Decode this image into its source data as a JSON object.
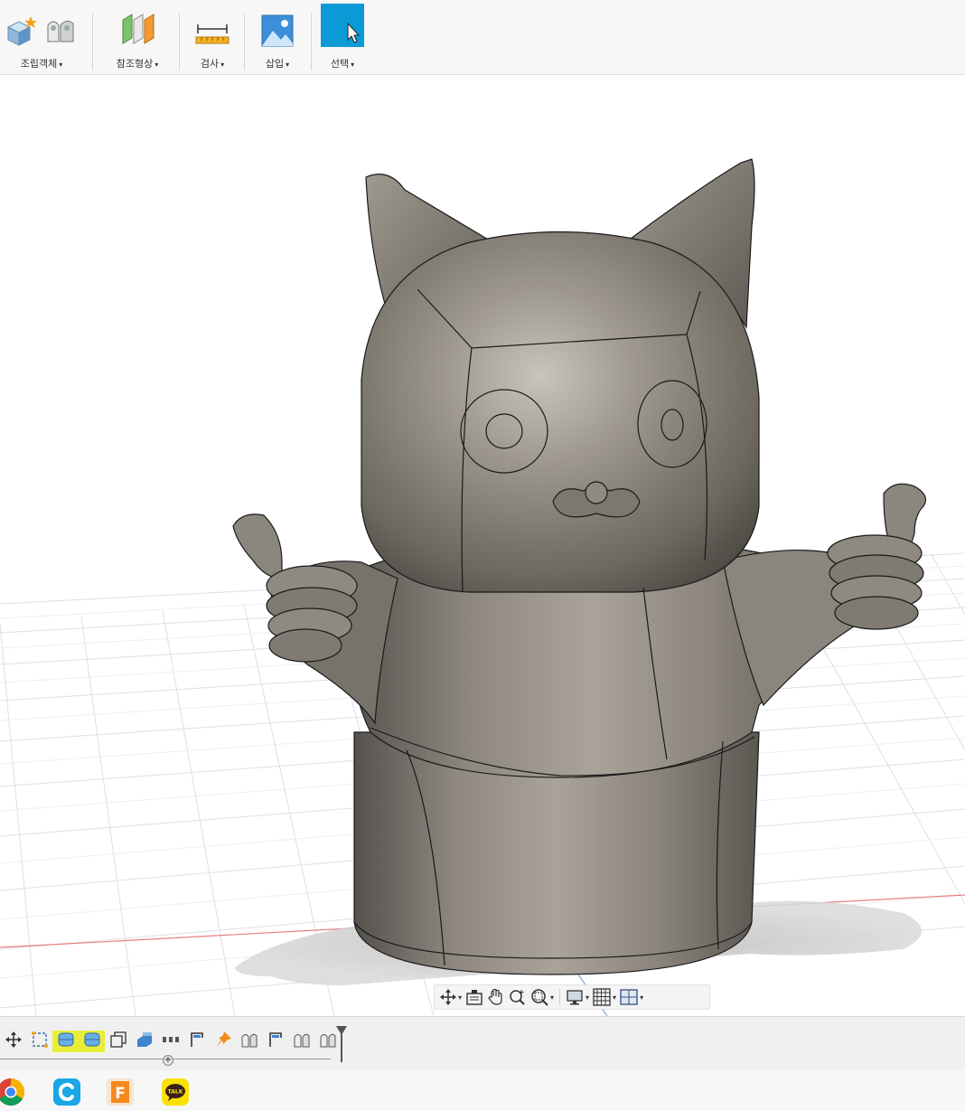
{
  "toolbar": {
    "groups": [
      {
        "label": "조립객체",
        "icons": [
          "new-component-icon",
          "joint-icon"
        ]
      },
      {
        "label": "참조형상",
        "icons": [
          "offset-plane-icon"
        ]
      },
      {
        "label": "검사",
        "icons": [
          "measure-icon"
        ]
      },
      {
        "label": "삽입",
        "icons": [
          "insert-image-icon"
        ]
      },
      {
        "label": "선택",
        "icons": [
          "select-icon"
        ]
      }
    ],
    "caret": "▾"
  },
  "navbar": {
    "tools": [
      "orbit-icon",
      "look-at-icon",
      "pan-icon",
      "zoom-icon",
      "fit-icon",
      "display-settings-icon",
      "grid-settings-icon",
      "viewports-icon"
    ],
    "caret": "▾"
  },
  "timeline": {
    "plus": "+",
    "features": [
      "move-feature-icon",
      "sketch-feature-icon",
      "form-feature-icon",
      "form-feature-icon",
      "shell-feature-icon",
      "body-feature-icon",
      "pattern-feature-icon",
      "plane-feature-icon",
      "pin-feature-icon",
      "joint-feature-icon",
      "plane-feature-icon",
      "joint-feature-icon",
      "joint-feature-icon"
    ],
    "highlighted": [
      2,
      3
    ]
  },
  "taskbar": {
    "apps": [
      "chrome-icon",
      "c-app-icon",
      "fusion-icon",
      "kakaotalk-icon"
    ],
    "kakaotalk_text": "TALK",
    "fusion_text": "F"
  },
  "colors": {
    "accent_select": "#0a9bd6",
    "timeline_highlight": "#e8ee3a",
    "model_body": "#8b857c",
    "grid_line": "#dcdfe6",
    "axis_red": "#e87f7f",
    "axis_blue": "#8aa6d6"
  }
}
